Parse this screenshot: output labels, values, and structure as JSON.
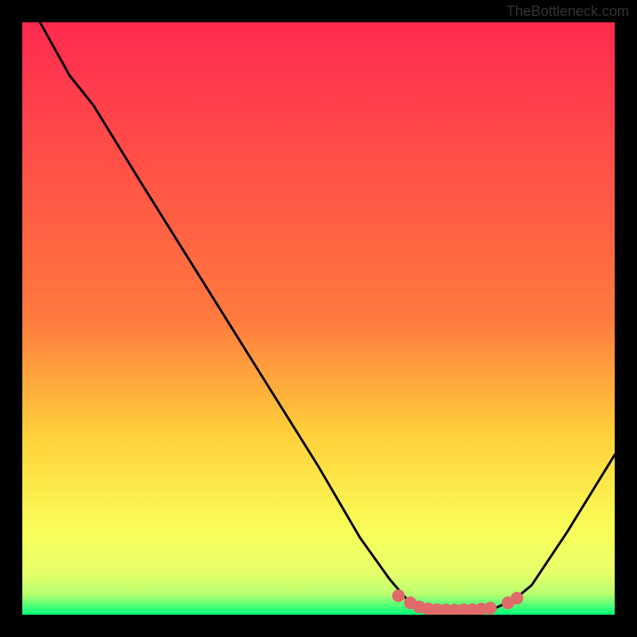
{
  "watermark": "TheBottleneck.com",
  "chart_data": {
    "type": "line",
    "title": "",
    "xlabel": "",
    "ylabel": "",
    "xlim": [
      0,
      100
    ],
    "ylim": [
      0,
      100
    ],
    "gradient_colors": {
      "top": "#ff2a4f",
      "upper_mid": "#ff7a3e",
      "mid": "#ffd23a",
      "lower_mid": "#f8ff5a",
      "bottom": "#00ff7a"
    },
    "curve": [
      {
        "x": 3,
        "y": 100
      },
      {
        "x": 8,
        "y": 91
      },
      {
        "x": 12,
        "y": 86
      },
      {
        "x": 20,
        "y": 73
      },
      {
        "x": 30,
        "y": 57
      },
      {
        "x": 40,
        "y": 41
      },
      {
        "x": 50,
        "y": 25
      },
      {
        "x": 57,
        "y": 13
      },
      {
        "x": 62,
        "y": 6
      },
      {
        "x": 65,
        "y": 2.5
      },
      {
        "x": 68,
        "y": 1.2
      },
      {
        "x": 72,
        "y": 0.8
      },
      {
        "x": 76,
        "y": 0.8
      },
      {
        "x": 80,
        "y": 1.2
      },
      {
        "x": 83,
        "y": 2.5
      },
      {
        "x": 86,
        "y": 5
      },
      {
        "x": 92,
        "y": 14
      },
      {
        "x": 100,
        "y": 27
      }
    ],
    "markers": [
      {
        "x": 63.5,
        "y": 3.2
      },
      {
        "x": 65.5,
        "y": 2.0
      },
      {
        "x": 67.0,
        "y": 1.3
      },
      {
        "x": 68.5,
        "y": 1.0
      },
      {
        "x": 70.0,
        "y": 0.85
      },
      {
        "x": 71.5,
        "y": 0.8
      },
      {
        "x": 73.0,
        "y": 0.78
      },
      {
        "x": 74.5,
        "y": 0.8
      },
      {
        "x": 76.0,
        "y": 0.85
      },
      {
        "x": 77.5,
        "y": 0.95
      },
      {
        "x": 79.0,
        "y": 1.1
      },
      {
        "x": 82.0,
        "y": 2.0
      },
      {
        "x": 83.5,
        "y": 2.8
      }
    ],
    "marker_color": "#e06a6a",
    "curve_color": "#000000"
  }
}
